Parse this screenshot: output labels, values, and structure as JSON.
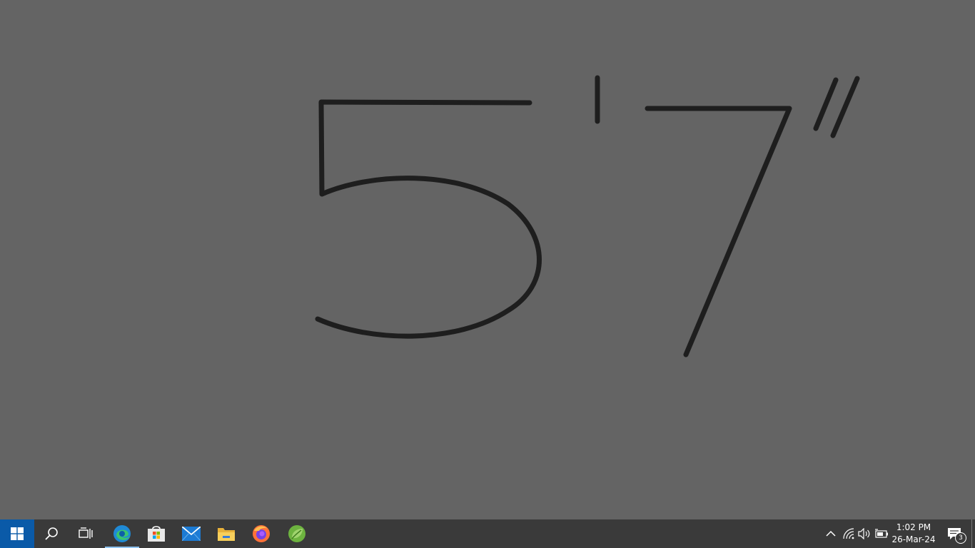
{
  "canvas": {
    "background": "#646464",
    "ink_color": "#1e1e1e",
    "handwritten_text": "5'7\""
  },
  "taskbar": {
    "background": "#3a3a3a",
    "apps": [
      {
        "name": "Start",
        "icon": "windows-logo-icon"
      },
      {
        "name": "Search",
        "icon": "search-icon"
      },
      {
        "name": "Task View",
        "icon": "task-view-icon"
      },
      {
        "name": "Microsoft Edge",
        "icon": "edge-icon",
        "active": true
      },
      {
        "name": "Microsoft Store",
        "icon": "store-icon"
      },
      {
        "name": "Mail",
        "icon": "mail-icon"
      },
      {
        "name": "File Explorer",
        "icon": "folder-icon"
      },
      {
        "name": "Firefox",
        "icon": "firefox-icon"
      },
      {
        "name": "Spring Tool Suite",
        "icon": "spring-leaf-icon"
      }
    ]
  },
  "tray": {
    "icons": [
      "chevron-up-icon",
      "network-icon",
      "volume-icon",
      "battery-icon"
    ],
    "time": "1:02 PM",
    "date": "26-Mar-24",
    "notification_count": "3"
  }
}
